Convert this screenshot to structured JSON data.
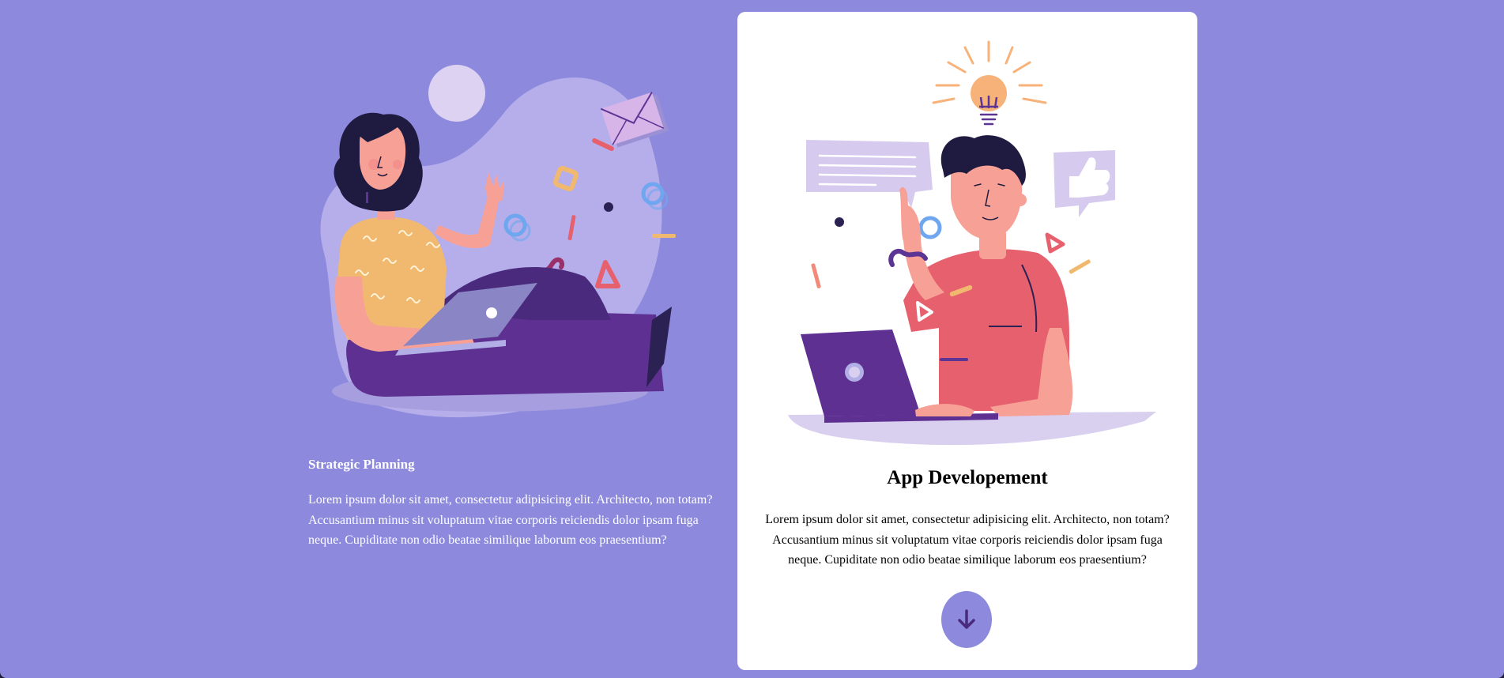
{
  "colors": {
    "background": "#8d8ade",
    "card": "#ffffff",
    "accent_purple": "#5b3494",
    "accent_pink": "#e7606e",
    "accent_yellow": "#f0b96f"
  },
  "left_card": {
    "illustration": "woman-with-laptop-illustration",
    "title": "Strategic Planning",
    "text": "Lorem ipsum dolor sit amet, consectetur adipisicing elit. Architecto, non totam? Accusantium minus sit voluptatum vitae corporis reiciendis dolor ipsam fuga neque. Cupiditate non odio beatae similique laborum eos praesentium?"
  },
  "right_card": {
    "illustration": "man-with-lightbulb-idea-illustration",
    "title": "App Developement",
    "text": "Lorem ipsum dolor sit amet, consectetur adipisicing elit. Architecto, non totam? Accusantium minus sit voluptatum vitae corporis reiciendis dolor ipsam fuga neque. Cupiditate non odio beatae similique laborum eos praesentium?",
    "button_icon": "arrow-down-icon"
  }
}
